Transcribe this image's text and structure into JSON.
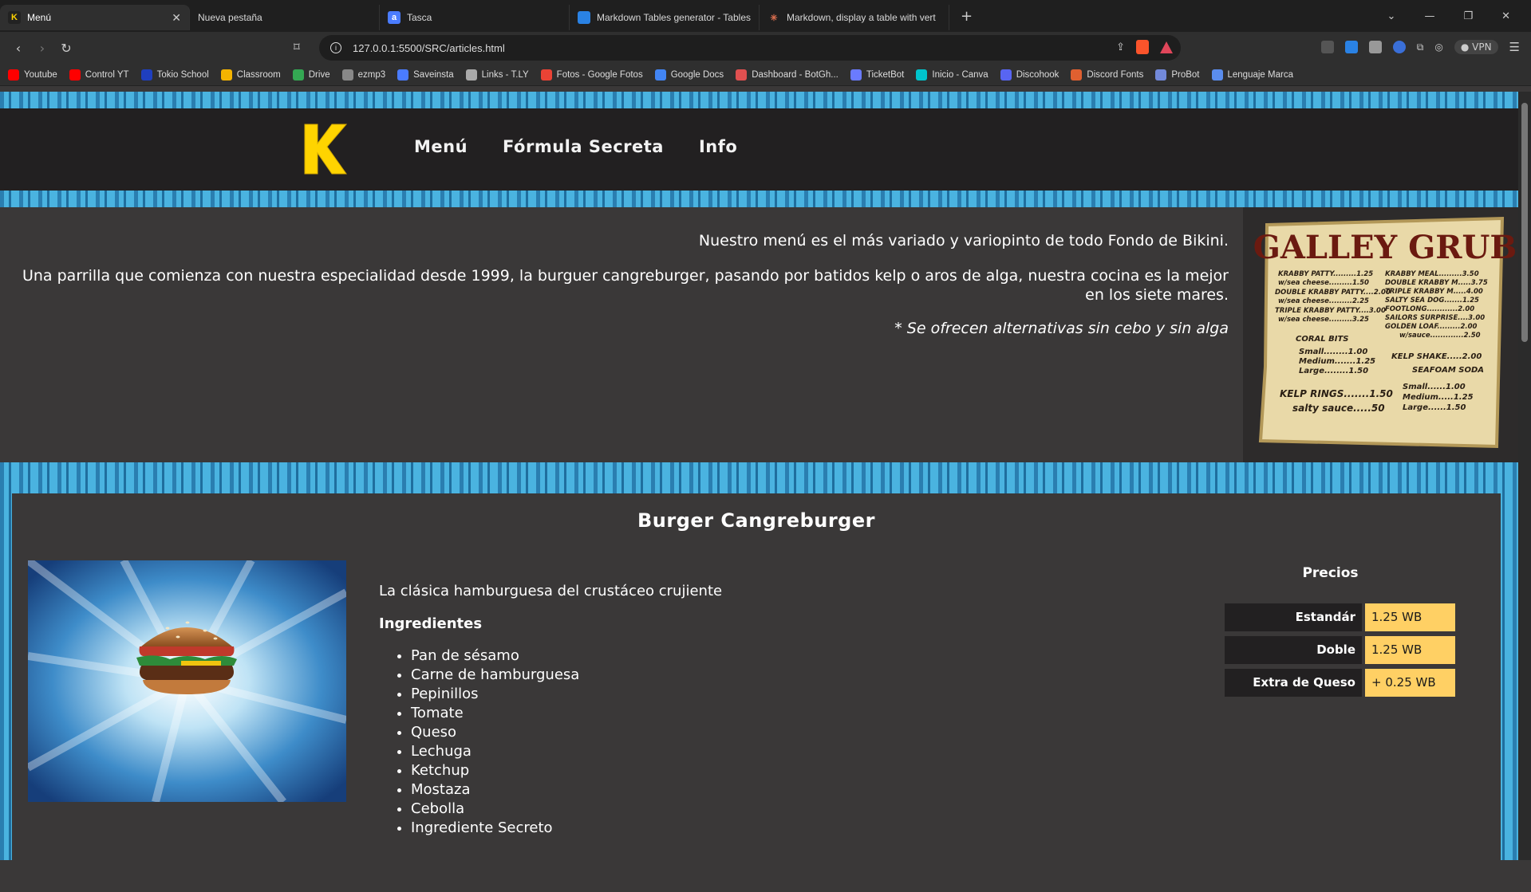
{
  "browser": {
    "tabs": [
      {
        "title": "Menú",
        "active": true,
        "icon": "k-logo-icon"
      },
      {
        "title": "Nueva pestaña",
        "active": false,
        "icon": ""
      },
      {
        "title": "Tasca",
        "active": false,
        "icon": "tasca-icon"
      },
      {
        "title": "Markdown Tables generator - Tables",
        "active": false,
        "icon": "table-icon"
      },
      {
        "title": "Markdown, display a table with vert",
        "active": false,
        "icon": "sparkle-icon"
      }
    ],
    "url": "127.0.0.1:5500/SRC/articles.html",
    "vpn_label": "VPN",
    "bookmarks": [
      {
        "label": "Youtube",
        "color": "#ff0000"
      },
      {
        "label": "Control YT",
        "color": "#ff0000"
      },
      {
        "label": "Tokio School",
        "color": "#1f3fbf"
      },
      {
        "label": "Classroom",
        "color": "#f4b400"
      },
      {
        "label": "Drive",
        "color": "#34a853"
      },
      {
        "label": "ezmp3",
        "color": "#888888"
      },
      {
        "label": "Saveinsta",
        "color": "#4a7cff"
      },
      {
        "label": "Links - T.LY",
        "color": "#aaaaaa"
      },
      {
        "label": "Fotos - Google Fotos",
        "color": "#ea4335"
      },
      {
        "label": "Google Docs",
        "color": "#4285f4"
      },
      {
        "label": "Dashboard - BotGh...",
        "color": "#e05050"
      },
      {
        "label": "TicketBot",
        "color": "#6a7bff"
      },
      {
        "label": "Inicio - Canva",
        "color": "#00c4cc"
      },
      {
        "label": "Discohook",
        "color": "#5865f2"
      },
      {
        "label": "Discord Fonts",
        "color": "#e06030"
      },
      {
        "label": "ProBot",
        "color": "#7289da"
      },
      {
        "label": "Lenguaje Marca",
        "color": "#5a8dee"
      }
    ]
  },
  "site": {
    "logo_letter": "K",
    "nav": [
      "Menú",
      "Fórmula Secreta",
      "Info"
    ],
    "intro": {
      "p1": "Nuestro menú es el más variado y variopinto de todo Fondo de Bikini.",
      "p2": "Una parrilla que comienza con nuestra especialidad desde 1999, la burguer cangreburger, pasando por batidos kelp o aros de alga, nuestra cocina es la mejor en los siete mares.",
      "note": "* Se ofrecen alternativas sin cebo y sin alga"
    },
    "menuboard_title": "GALLEY GRUB",
    "menuboard": {
      "rows_left": [
        "KRABBY PATTY.........1.25",
        "w/sea cheese.........1.50",
        "DOUBLE KRABBY PATTY....2.00",
        "w/sea cheese.........2.25",
        "TRIPLE KRABBY PATTY....3.00",
        "w/sea cheese.........3.25"
      ],
      "rows_right": [
        "KRABBY MEAL.........3.50",
        "DOUBLE KRABBY M.....3.75",
        "TRIPLE KRABBY M.....4.00",
        "SALTY SEA DOG.......1.25",
        "FOOTLONG............2.00",
        "SAILORS SURPRISE....3.00",
        "GOLDEN LOAF.........2.00",
        "w/sauce.............2.50"
      ],
      "coral_title": "CORAL BITS",
      "coral": [
        "Small........1.00",
        "Medium.......1.25",
        "Large........1.50"
      ],
      "kelp_shake": "KELP SHAKE.....2.00",
      "soda_title": "SEAFOAM SODA",
      "soda": [
        "Small......1.00",
        "Medium.....1.25",
        "Large......1.50"
      ],
      "kelp_rings": "KELP RINGS.......1.50",
      "salty_sauce": "salty sauce.....50"
    },
    "product": {
      "title": "Burger Cangreburger",
      "lead": "La clásica hamburguesa del crustáceo crujiente",
      "ingredients_title": "Ingredientes",
      "ingredients": [
        "Pan de sésamo",
        "Carne de hamburguesa",
        "Pepinillos",
        "Tomate",
        "Queso",
        "Lechuga",
        "Ketchup",
        "Mostaza",
        "Cebolla",
        "Ingrediente Secreto"
      ],
      "prices_title": "Precios",
      "prices": [
        {
          "label": "Estandár",
          "value": "1.25 WB"
        },
        {
          "label": "Doble",
          "value": "1.25 WB"
        },
        {
          "label": "Extra de Queso",
          "value": "+ 0.25 WB"
        }
      ]
    }
  }
}
